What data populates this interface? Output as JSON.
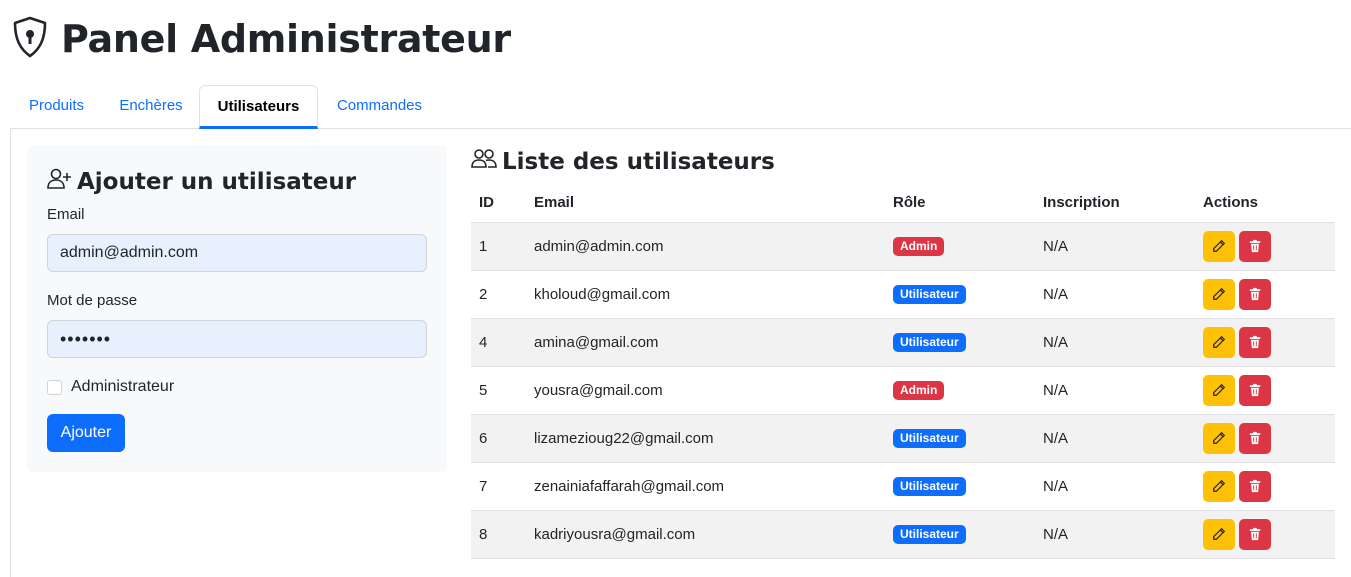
{
  "header": {
    "title": "Panel Administrateur",
    "icon": "shield-lock-icon"
  },
  "tabs": [
    {
      "label": "Produits",
      "active": false
    },
    {
      "label": "Enchères",
      "active": false
    },
    {
      "label": "Utilisateurs",
      "active": true
    },
    {
      "label": "Commandes",
      "active": false
    }
  ],
  "add_form": {
    "title": "Ajouter un utilisateur",
    "icon": "person-plus-icon",
    "email_label": "Email",
    "email_value": "admin@admin.com",
    "password_label": "Mot de passe",
    "password_value": "•••••••",
    "admin_checkbox_label": "Administrateur",
    "admin_checked": false,
    "submit_label": "Ajouter"
  },
  "user_list": {
    "title": "Liste des utilisateurs",
    "icon": "people-icon",
    "columns": [
      "ID",
      "Email",
      "Rôle",
      "Inscription",
      "Actions"
    ],
    "rows": [
      {
        "id": "1",
        "email": "admin@admin.com",
        "role": "Admin",
        "role_type": "admin",
        "inscription": "N/A"
      },
      {
        "id": "2",
        "email": "kholoud@gmail.com",
        "role": "Utilisateur",
        "role_type": "user",
        "inscription": "N/A"
      },
      {
        "id": "4",
        "email": "amina@gmail.com",
        "role": "Utilisateur",
        "role_type": "user",
        "inscription": "N/A"
      },
      {
        "id": "5",
        "email": "yousra@gmail.com",
        "role": "Admin",
        "role_type": "admin",
        "inscription": "N/A"
      },
      {
        "id": "6",
        "email": "lizamezioug22@gmail.com",
        "role": "Utilisateur",
        "role_type": "user",
        "inscription": "N/A"
      },
      {
        "id": "7",
        "email": "zenainiafaffarah@gmail.com",
        "role": "Utilisateur",
        "role_type": "user",
        "inscription": "N/A"
      },
      {
        "id": "8",
        "email": "kadriyousra@gmail.com",
        "role": "Utilisateur",
        "role_type": "user",
        "inscription": "N/A"
      }
    ]
  },
  "colors": {
    "primary": "#0d6efd",
    "danger": "#dc3545",
    "warning": "#ffc107",
    "card_bg": "#f8f9fa"
  }
}
